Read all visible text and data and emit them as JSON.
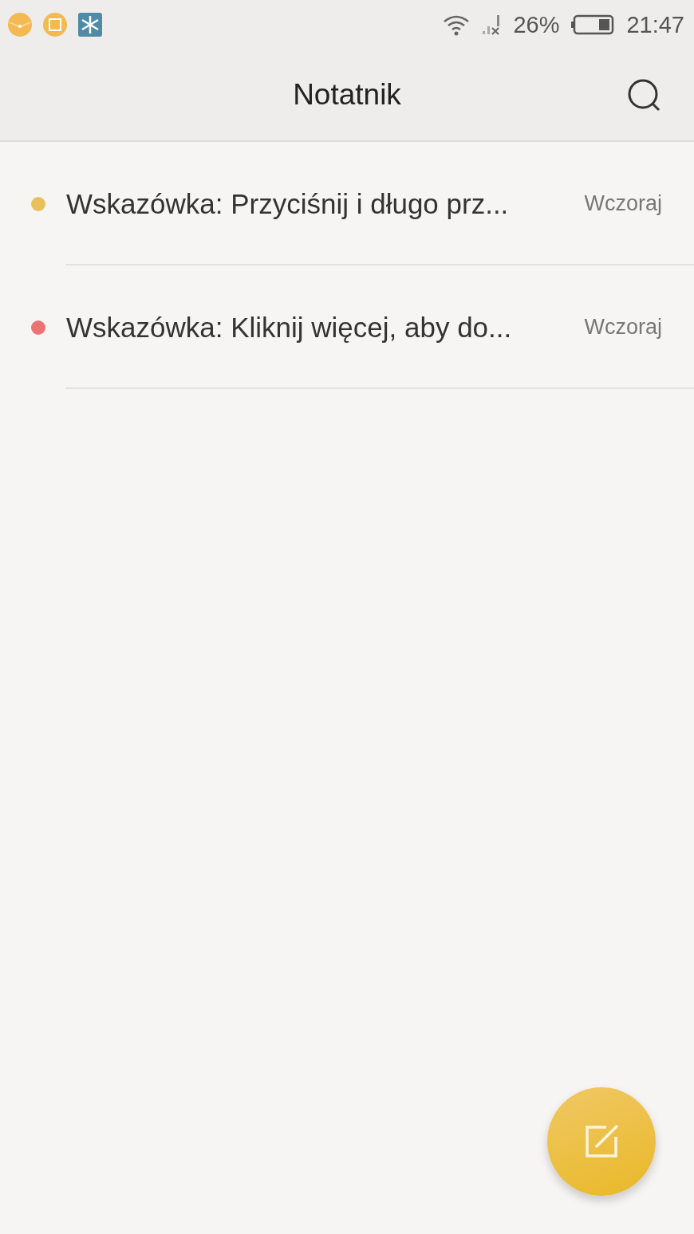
{
  "status_bar": {
    "battery": "26%",
    "time": "21:47"
  },
  "header": {
    "title": "Notatnik"
  },
  "notes": [
    {
      "title": "Wskazówka: Przyciśnij i długo prz...",
      "date": "Wczoraj",
      "color": "#e8c15c"
    },
    {
      "title": "Wskazówka: Kliknij więcej, aby do...",
      "date": "Wczoraj",
      "color": "#ea7474"
    }
  ]
}
